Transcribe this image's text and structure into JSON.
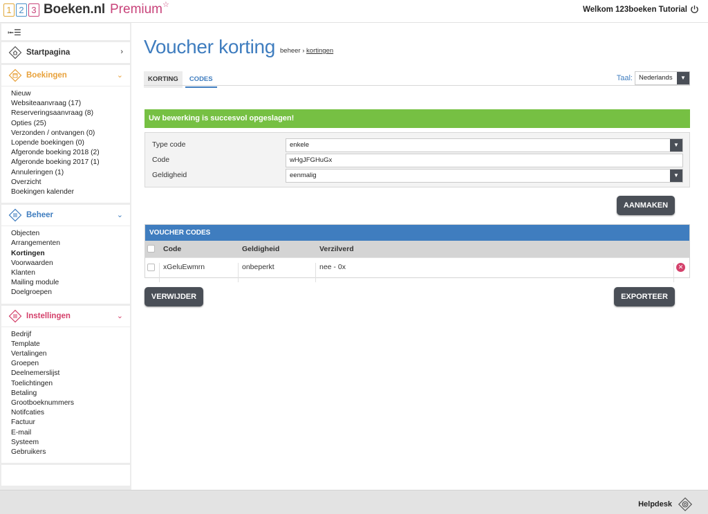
{
  "logo": {
    "digits": [
      "1",
      "2",
      "3"
    ],
    "digit_colors": [
      "#e0a83a",
      "#4a90c8",
      "#c8437a"
    ],
    "name": "Boeken.nl",
    "premium": "Premium",
    "star": "☆"
  },
  "user": {
    "welcome": "Welkom 123boeken Tutorial",
    "icon": "power-icon"
  },
  "sidebar": {
    "toggle_icon": "menu-collapse-icon",
    "home": {
      "label": "Startpagina",
      "icon": "house-icon"
    },
    "boekingen": {
      "title": "Boekingen",
      "color": "#e8a13a",
      "icon": "calendar-icon",
      "items": [
        "Nieuw",
        "Websiteaanvraag (17)",
        "Reserveringsaanvraag (8)",
        "Opties (25)",
        "Verzonden / ontvangen (0)",
        "Lopende boekingen (0)",
        "Afgeronde boeking 2018 (2)",
        "Afgeronde boeking 2017 (1)",
        "Annuleringen (1)",
        "Overzicht",
        "Boekingen kalender"
      ]
    },
    "beheer": {
      "title": "Beheer",
      "color": "#3f7dbf",
      "icon": "list-icon",
      "items": [
        "Objecten",
        "Arrangementen",
        "Kortingen",
        "Voorwaarden",
        "Klanten",
        "Mailing module",
        "Doelgroepen"
      ],
      "active": "Kortingen"
    },
    "instellingen": {
      "title": "Instellingen",
      "color": "#d4416b",
      "icon": "sliders-icon",
      "items": [
        "Bedrijf",
        "Template",
        "Vertalingen",
        "Groepen",
        "Deelnemerslijst",
        "Toelichtingen",
        "Betaling",
        "Grootboeknummers",
        "Notifcaties",
        "Factuur",
        "E-mail",
        "Systeem",
        "Gebruikers"
      ]
    }
  },
  "page": {
    "title": "Voucher korting",
    "crumb_base": "beheer",
    "crumb_sep": "›",
    "crumb_link": "kortingen"
  },
  "tabs": [
    {
      "label": "KORTING"
    },
    {
      "label": "CODES"
    }
  ],
  "taal": {
    "label": "Taal:",
    "value": "Nederlands"
  },
  "success_message": "Uw bewerking is succesvol opgeslagen!",
  "form": {
    "type_label": "Type code",
    "type_value": "enkele",
    "code_label": "Code",
    "code_value": "wHgJFGHuGx",
    "geldigheid_label": "Geldigheid",
    "geldigheid_value": "eenmalig"
  },
  "buttons": {
    "aanmaken": "AANMAKEN",
    "verwijder": "VERWIJDER",
    "exporteer": "EXPORTEER"
  },
  "voucher_table": {
    "title": "VOUCHER CODES",
    "columns": [
      "Code",
      "Geldigheid",
      "Verzilverd"
    ],
    "rows": [
      {
        "code": "xGeluEwmrn",
        "geldigheid": "onbeperkt",
        "verzilverd": "nee - 0x"
      }
    ]
  },
  "footer": {
    "helpdesk": "Helpdesk"
  },
  "colors": {
    "accent": "#3f7dbf",
    "success": "#76c043",
    "button": "#4a4f57",
    "danger": "#d4416b"
  }
}
